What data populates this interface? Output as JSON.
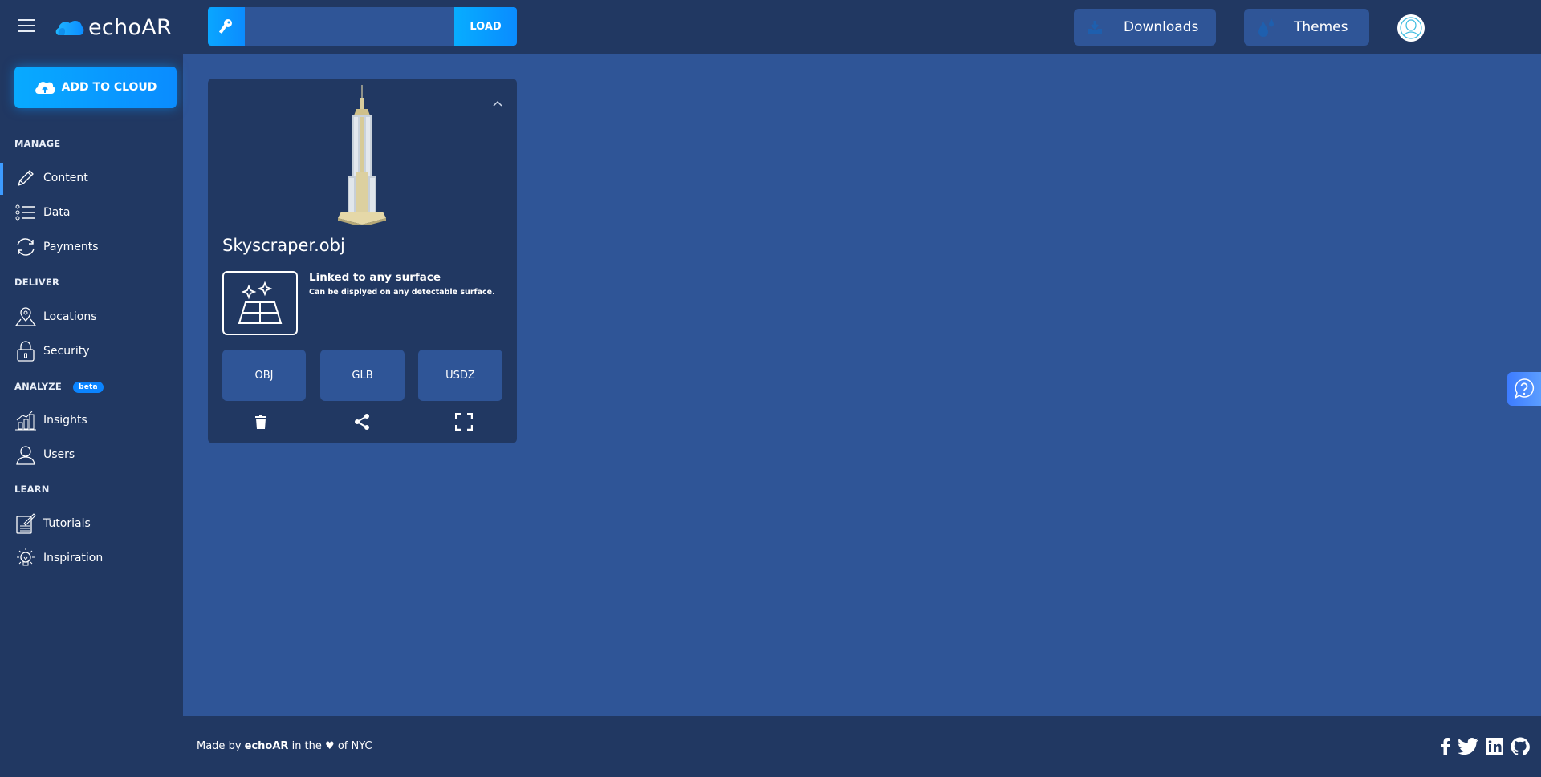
{
  "header": {
    "logo_text": "echoAR",
    "key_input": {
      "value": "",
      "placeholder": ""
    },
    "load_label": "LOAD",
    "downloads_label": "Downloads",
    "themes_label": "Themes"
  },
  "sidebar": {
    "add_to_cloud_label": "ADD TO CLOUD",
    "sections": [
      {
        "label": "MANAGE",
        "items": [
          {
            "label": "Content",
            "icon": "pencil-icon",
            "active": true
          },
          {
            "label": "Data",
            "icon": "list-icon"
          },
          {
            "label": "Payments",
            "icon": "refresh-icon"
          }
        ]
      },
      {
        "label": "DELIVER",
        "items": [
          {
            "label": "Locations",
            "icon": "map-pin-icon"
          },
          {
            "label": "Security",
            "icon": "lock-icon"
          }
        ]
      },
      {
        "label": "ANALYZE",
        "badge": "beta",
        "items": [
          {
            "label": "Insights",
            "icon": "chart-icon"
          },
          {
            "label": "Users",
            "icon": "user-icon"
          }
        ]
      },
      {
        "label": "LEARN",
        "items": [
          {
            "label": "Tutorials",
            "icon": "notebook-icon"
          },
          {
            "label": "Inspiration",
            "icon": "lightbulb-icon"
          }
        ]
      }
    ]
  },
  "card": {
    "title": "Skyscraper.obj",
    "surface_title": "Linked to any surface",
    "surface_desc": "Can be displyed on any detectable surface.",
    "formats": [
      "OBJ",
      "GLB",
      "USDZ"
    ]
  },
  "footer": {
    "prefix": "Made by",
    "brand": "echoAR",
    "middle": "in the",
    "heart": "♥",
    "suffix": "of NYC"
  },
  "colors": {
    "accent": "#0a9cff",
    "background": "#2f5597",
    "panel": "#213862",
    "active_indicator": "#3d9bff"
  }
}
